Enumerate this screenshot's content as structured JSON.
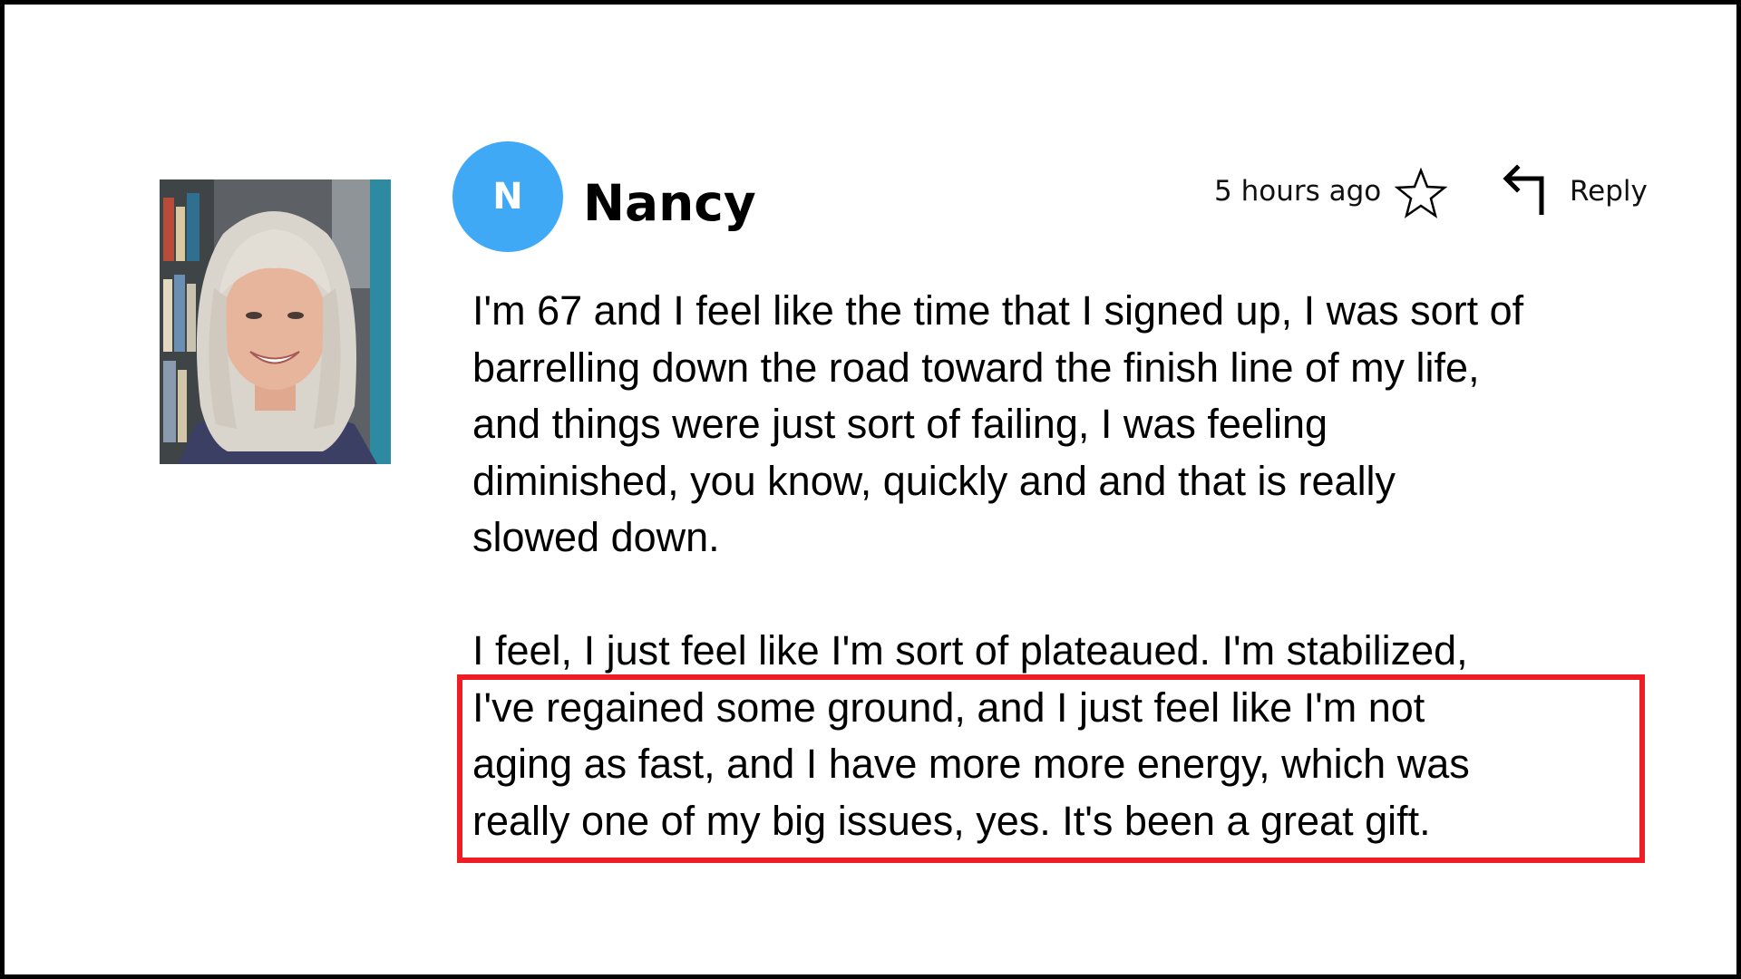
{
  "comment": {
    "author_initial": "N",
    "author_name": "Nancy",
    "timestamp": "5 hours ago",
    "reply_label": "Reply",
    "paragraph_1_lines": [
      "I'm 67 and I feel like the time that I signed up, I was sort of",
      "barrelling down the road toward the finish line of my life,",
      "and things were just sort of failing, I was feeling",
      "diminished, you know, quickly and and that is really",
      "slowed down."
    ],
    "paragraph_2_lines": [
      "I feel, I just feel like I'm sort of plateaued. I'm stabilized,",
      "I've regained some ground, and I just feel like I'm not",
      "aging as fast, and I have more more energy, which was",
      "really one of my big issues, yes. It's been a great gift."
    ]
  },
  "icons": {
    "star": "star-icon",
    "reply": "reply-arrow-icon"
  },
  "colors": {
    "avatar_bg": "#3fa9f5",
    "highlight_border": "#ee1c24",
    "frame_border": "#000000"
  }
}
